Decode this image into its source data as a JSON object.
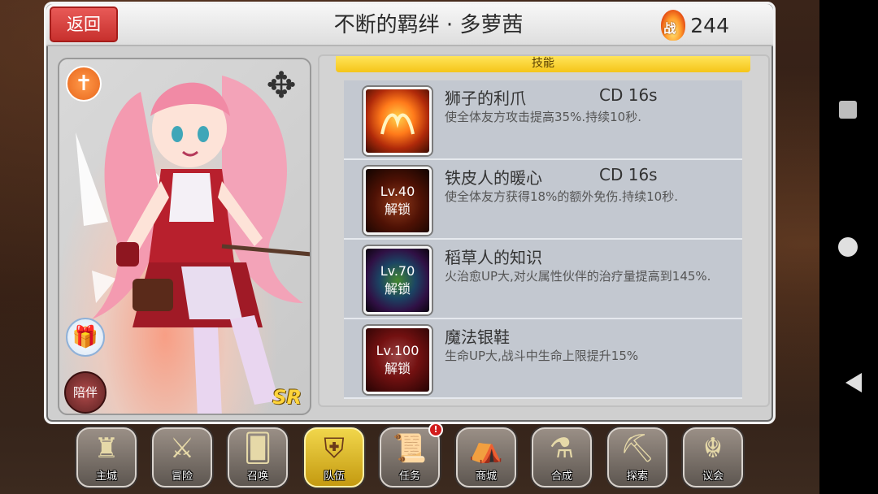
{
  "header": {
    "back_label": "返回",
    "title": "不断的羁绊 · 多萝茜",
    "power_icon_label": "战",
    "power_value": "244"
  },
  "character": {
    "companion_label": "陪伴",
    "rank": "SR",
    "icons": [
      "cross-icon",
      "element-icon",
      "gift-icon"
    ]
  },
  "skills": {
    "header": "技能",
    "items": [
      {
        "name": "狮子的利爪",
        "cd": "CD  16s",
        "desc": "使全体友方攻击提高35%.持续10秒.",
        "lock_level": "",
        "lock_text": "",
        "icon": "lion-claw-icon"
      },
      {
        "name": "铁皮人的暖心",
        "cd": "CD  16s",
        "desc": "使全体友方获得18%的额外免伤.持续10秒.",
        "lock_level": "Lv.40",
        "lock_text": "解锁",
        "icon": "tin-heart-icon"
      },
      {
        "name": "稻草人的知识",
        "cd": "",
        "desc": "火治愈UP大,对火属性伙伴的治疗量提高到145%.",
        "lock_level": "Lv.70",
        "lock_text": "解锁",
        "icon": "scarecrow-knowledge-icon"
      },
      {
        "name": "魔法银鞋",
        "cd": "",
        "desc": "生命UP大,战斗中生命上限提升15%",
        "lock_level": "Lv.100",
        "lock_text": "解锁",
        "icon": "silver-shoes-icon"
      }
    ]
  },
  "menu": {
    "items": [
      {
        "label": "主城",
        "icon": "castle-icon"
      },
      {
        "label": "冒险",
        "icon": "crossed-axes-icon"
      },
      {
        "label": "召唤",
        "icon": "summon-card-icon"
      },
      {
        "label": "队伍",
        "icon": "team-crest-icon",
        "active": true
      },
      {
        "label": "任务",
        "icon": "quest-book-icon",
        "alert": "!"
      },
      {
        "label": "商城",
        "icon": "shop-icon"
      },
      {
        "label": "合成",
        "icon": "synthesis-icon"
      },
      {
        "label": "探索",
        "icon": "explore-icon"
      },
      {
        "label": "议会",
        "icon": "council-icon"
      }
    ]
  },
  "colors": {
    "accent_red": "#d63e3b",
    "skill_header_yellow": "#f5c518",
    "active_menu": "#e8c534"
  }
}
